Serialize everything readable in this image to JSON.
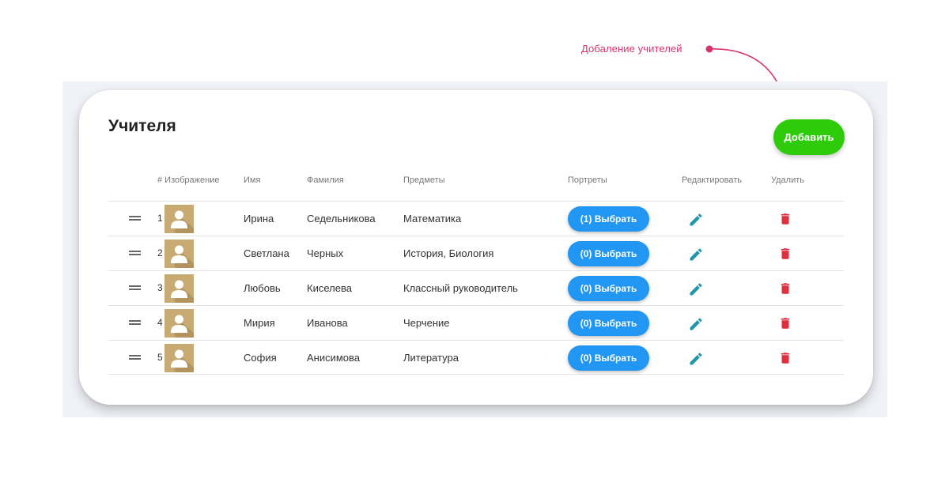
{
  "annotation": {
    "text": "Добаление учителей"
  },
  "card": {
    "title": "Учителя",
    "add_label": "Добавить"
  },
  "columns": {
    "index_image": "# Изображение",
    "name": "Имя",
    "surname": "Фамилия",
    "subjects": "Предметы",
    "portraits": "Портреты",
    "edit": "Редактировать",
    "delete": "Удалить"
  },
  "rows": [
    {
      "index": "1",
      "name": "Ирина",
      "surname": "Седельникова",
      "subjects": "Математика",
      "portraits": "(1) Выбрать"
    },
    {
      "index": "2",
      "name": "Светлана",
      "surname": "Черных",
      "subjects": "История, Биология",
      "portraits": "(0) Выбрать"
    },
    {
      "index": "3",
      "name": "Любовь",
      "surname": "Киселева",
      "subjects": "Классный руководитель",
      "portraits": "(0) Выбрать"
    },
    {
      "index": "4",
      "name": "Мирия",
      "surname": "Иванова",
      "subjects": "Черчение",
      "portraits": "(0) Выбрать"
    },
    {
      "index": "5",
      "name": "София",
      "surname": "Анисимова",
      "subjects": "Литература",
      "portraits": "(0) Выбрать"
    }
  ],
  "icons": {
    "drag": "drag-handle-icon",
    "avatar": "user-placeholder-icon",
    "edit": "pencil-icon",
    "delete": "trash-icon"
  },
  "colors": {
    "annotation": "#d9336b",
    "add_button": "#2ecb0a",
    "select_button": "#2196f3",
    "edit_icon": "#1e97a8",
    "delete_icon": "#e02e3c",
    "avatar_bg": "#c8ab72"
  }
}
